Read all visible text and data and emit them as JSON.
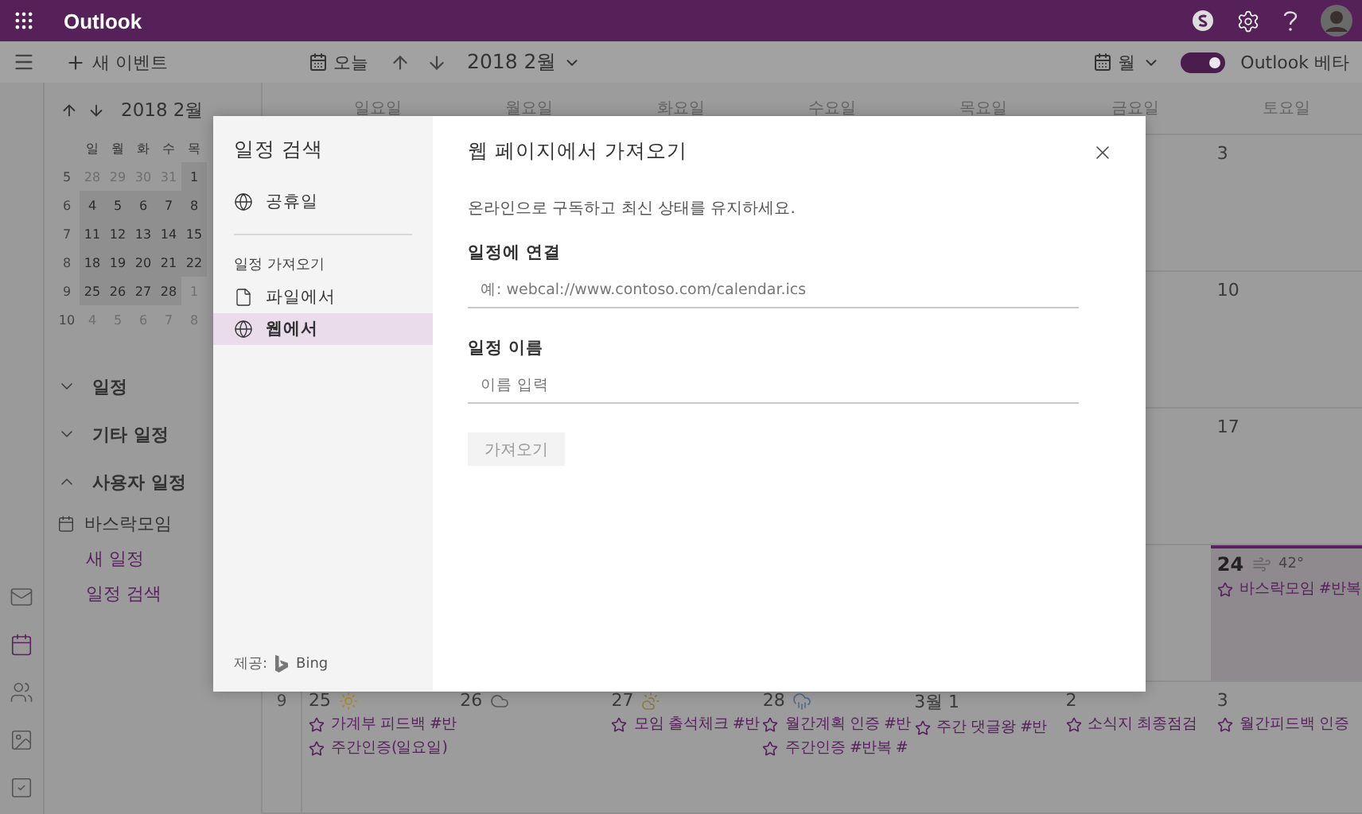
{
  "app": {
    "title": "Outlook"
  },
  "command_bar": {
    "new_event": "새 이벤트",
    "today": "오늘",
    "period": "2018 2월",
    "view": "월",
    "beta_toggle": {
      "label": "Outlook 베타",
      "on": true
    }
  },
  "mini_calendar": {
    "title": "2018 2월",
    "weekdays": [
      "일",
      "월",
      "화",
      "수",
      "목"
    ],
    "weeks": [
      {
        "number": "5",
        "days": [
          {
            "day": "28",
            "in_month": false
          },
          {
            "day": "29",
            "in_month": false
          },
          {
            "day": "30",
            "in_month": false
          },
          {
            "day": "31",
            "in_month": false
          },
          {
            "day": "1",
            "in_month": true
          }
        ]
      },
      {
        "number": "6",
        "days": [
          {
            "day": "4",
            "in_month": true
          },
          {
            "day": "5",
            "in_month": true
          },
          {
            "day": "6",
            "in_month": true
          },
          {
            "day": "7",
            "in_month": true
          },
          {
            "day": "8",
            "in_month": true
          }
        ]
      },
      {
        "number": "7",
        "days": [
          {
            "day": "11",
            "in_month": true
          },
          {
            "day": "12",
            "in_month": true
          },
          {
            "day": "13",
            "in_month": true
          },
          {
            "day": "14",
            "in_month": true
          },
          {
            "day": "15",
            "in_month": true
          }
        ]
      },
      {
        "number": "8",
        "days": [
          {
            "day": "18",
            "in_month": true
          },
          {
            "day": "19",
            "in_month": true
          },
          {
            "day": "20",
            "in_month": true
          },
          {
            "day": "21",
            "in_month": true
          },
          {
            "day": "22",
            "in_month": true
          }
        ]
      },
      {
        "number": "9",
        "days": [
          {
            "day": "25",
            "in_month": true
          },
          {
            "day": "26",
            "in_month": true
          },
          {
            "day": "27",
            "in_month": true
          },
          {
            "day": "28",
            "in_month": true
          },
          {
            "day": "1",
            "in_month": false
          }
        ]
      },
      {
        "number": "10",
        "days": [
          {
            "day": "4",
            "in_month": false
          },
          {
            "day": "5",
            "in_month": false
          },
          {
            "day": "6",
            "in_month": false
          },
          {
            "day": "7",
            "in_month": false
          },
          {
            "day": "8",
            "in_month": false
          }
        ]
      }
    ]
  },
  "folders": [
    {
      "label": "일정",
      "expanded": false
    },
    {
      "label": "기타 일정",
      "expanded": false
    },
    {
      "label": "사용자 일정",
      "expanded": true,
      "children": [
        {
          "label": "바스락모임",
          "kind": "calendar"
        },
        {
          "label": "새 일정",
          "kind": "link"
        },
        {
          "label": "일정 검색",
          "kind": "link"
        }
      ]
    }
  ],
  "rail": [
    {
      "selected": false
    },
    {
      "selected": true
    },
    {
      "selected": false
    },
    {
      "selected": false
    },
    {
      "selected": false
    }
  ],
  "calendar": {
    "weekdays": [
      "일요일",
      "월요일",
      "화요일",
      "수요일",
      "목요일",
      "금요일",
      "토요일"
    ],
    "weeks": [
      {
        "days": [
          {
            "date": "3",
            "today": false,
            "kind": "plain"
          }
        ]
      },
      {
        "days": [
          {
            "date": "10",
            "today": false,
            "kind": "plain"
          }
        ]
      },
      {
        "days": [
          {
            "date": "17",
            "today": false,
            "kind": "plain"
          }
        ]
      },
      {
        "days": [
          {
            "date": "24",
            "today": true,
            "kind": "wind",
            "temperature": "42°",
            "events": [
              "바스락모임 #반복"
            ]
          }
        ]
      },
      {
        "number": "9",
        "days": [
          {
            "date": "25",
            "today": false,
            "kind": "sun",
            "events": [
              "가계부 피드백 #반",
              "주간인증(일요일)"
            ]
          },
          {
            "date": "26",
            "today": false,
            "kind": "cloud"
          },
          {
            "date": "27",
            "today": false,
            "kind": "partly-cloudy",
            "events": [
              "모임 출석체크 #반"
            ]
          },
          {
            "date": "28",
            "today": false,
            "kind": "rain",
            "events": [
              "월간계획 인증 #반",
              "주간인증 #반복 #"
            ]
          },
          {
            "date": "3월 1",
            "today": false,
            "kind": "plain",
            "events": [
              "주간 댓글왕 #반"
            ]
          },
          {
            "date": "2",
            "today": false,
            "kind": "plain",
            "events": [
              "소식지 최종점검"
            ]
          },
          {
            "date": "3",
            "today": false,
            "kind": "plain",
            "events": [
              "월간피드백 인증"
            ]
          }
        ]
      }
    ]
  },
  "dialog": {
    "title": "일정 검색",
    "sources": [
      {
        "label": "공휴일",
        "selected": false
      }
    ],
    "import_heading": "일정 가져오기",
    "import_options": [
      {
        "label": "파일에서",
        "kind": "file",
        "selected": false
      },
      {
        "label": "웹에서",
        "kind": "web",
        "selected": true
      }
    ],
    "provider_label": "제공:",
    "provider": "Bing",
    "page_title": "웹 페이지에서 가져오기",
    "description": "온라인으로 구독하고 최신 상태를 유지하세요.",
    "fields": [
      {
        "label": "일정에 연결",
        "placeholder": "예: webcal://www.contoso.com/calendar.ics"
      },
      {
        "label": "일정 이름",
        "placeholder": "이름 입력"
      }
    ],
    "submit": {
      "label": "가져오기",
      "disabled": true
    }
  }
}
